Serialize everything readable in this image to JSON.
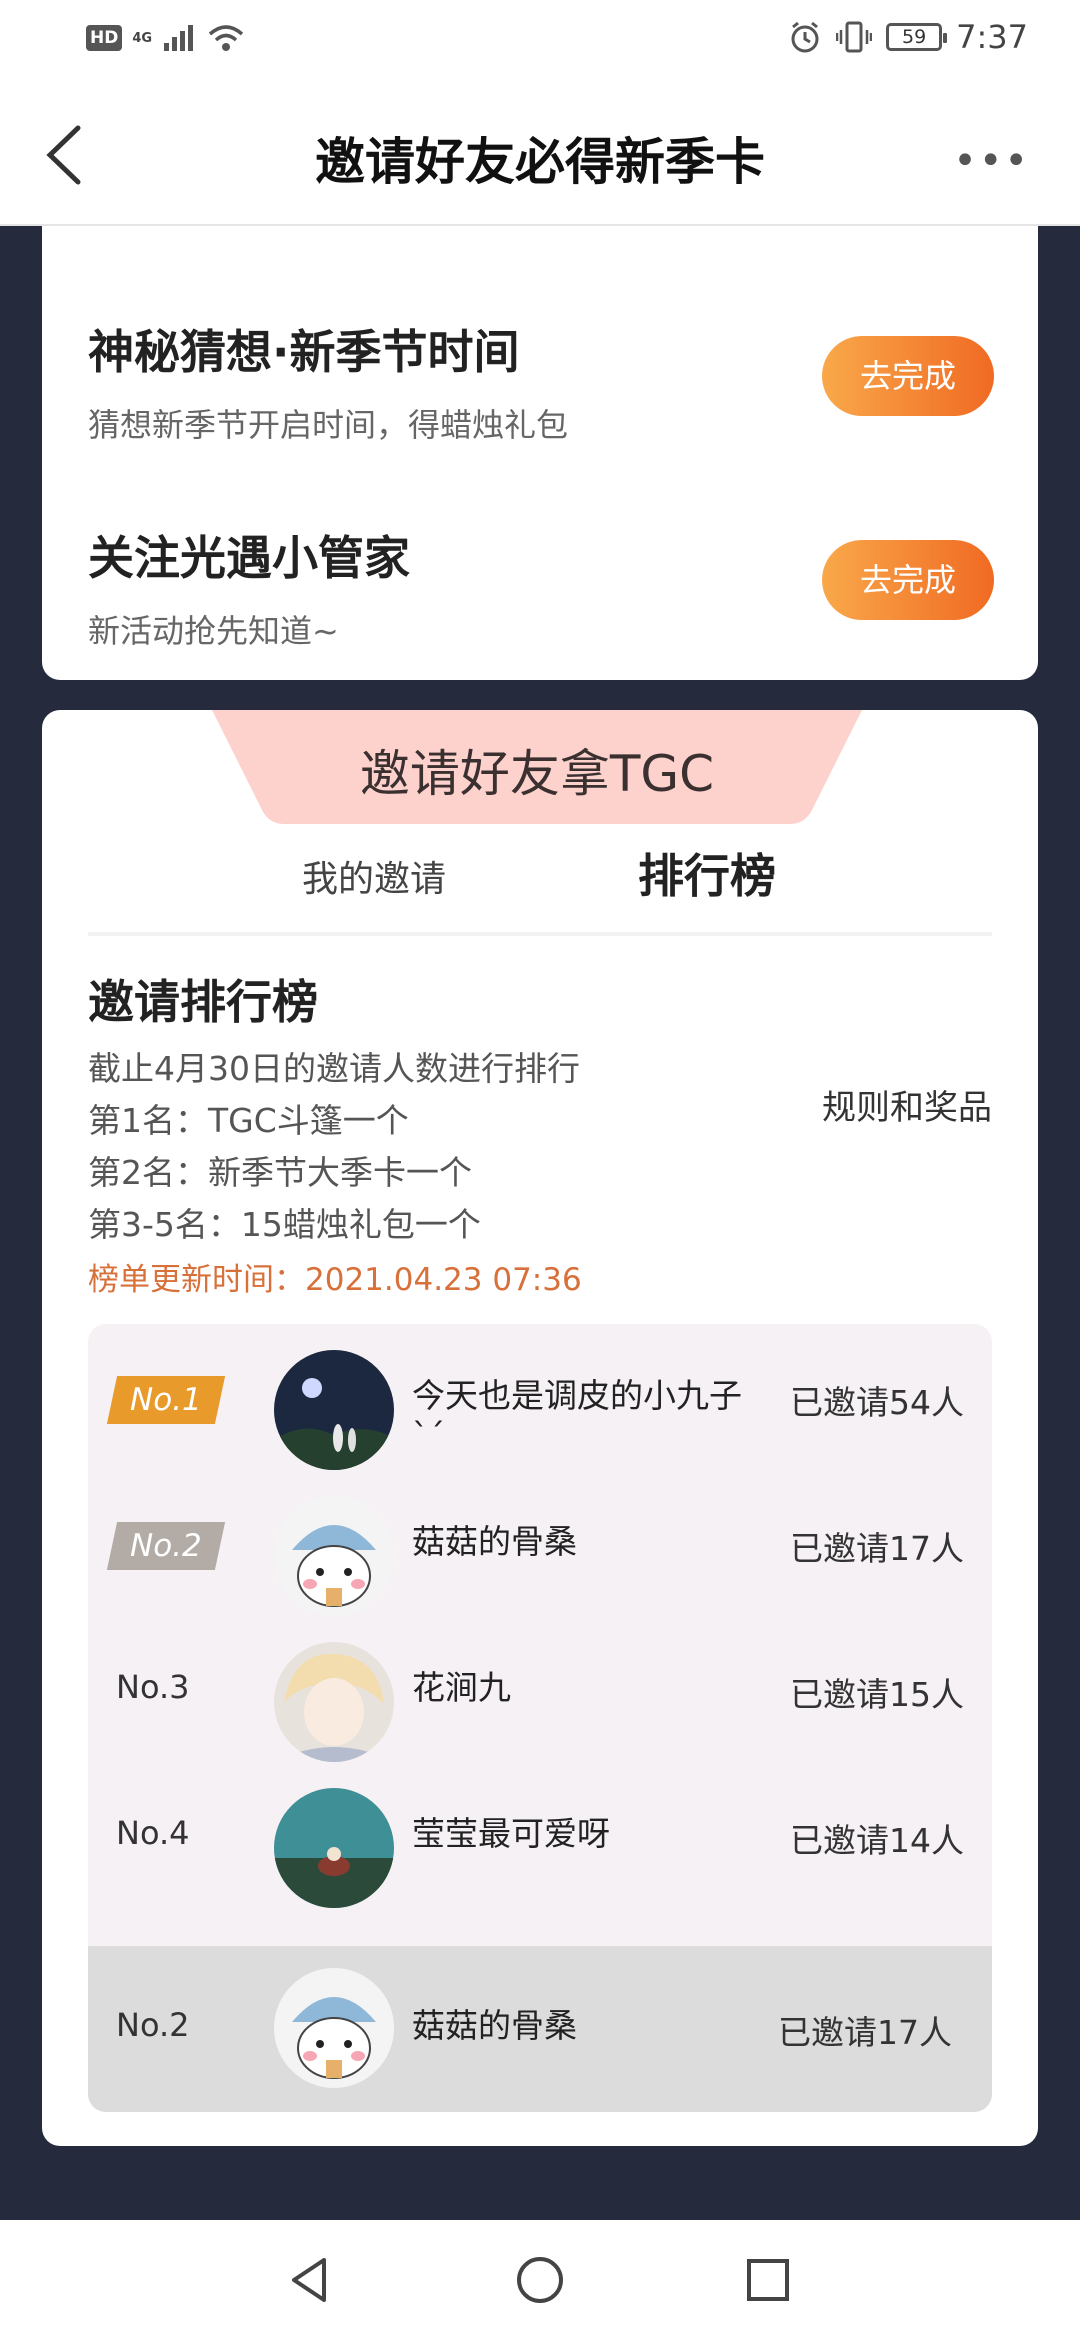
{
  "status_bar": {
    "hd": "HD",
    "network": "4G",
    "battery": "59",
    "time": "7:37"
  },
  "header": {
    "title": "邀请好友必得新季卡",
    "more": "•••"
  },
  "tasks": [
    {
      "title": "神秘猜想·新季节时间",
      "subtitle": "猜想新季节开启时间，得蜡烛礼包",
      "button": "去完成"
    },
    {
      "title": "关注光遇小管家",
      "subtitle": "新活动抢先知道~",
      "button": "去完成"
    }
  ],
  "invite": {
    "banner": "邀请好友拿TGC",
    "tabs": {
      "my_invites": "我的邀请",
      "leaderboard": "排行榜"
    },
    "rank_title": "邀请排行榜",
    "rules": [
      "截止4月30日的邀请人数进行排行",
      "第1名：TGC斗篷一个",
      "第2名：新季节大季卡一个",
      "第3-5名：15蜡烛礼包一个"
    ],
    "update_time": "榜单更新时间：2021.04.23 07:36",
    "rules_link": "规则和奖品"
  },
  "colors": {
    "accent": "#f06a23",
    "banner_pink": "#fdd1cc",
    "gold": "#e89a2a",
    "silver": "#b3aca6"
  },
  "leaderboard": [
    {
      "rank": "No.1",
      "name": "今天也是调皮的小九子ˋˊ",
      "invited": "已邀请54人"
    },
    {
      "rank": "No.2",
      "name": "菇菇的骨桑",
      "invited": "已邀请17人"
    },
    {
      "rank": "No.3",
      "name": "花涧九",
      "invited": "已邀请15人"
    },
    {
      "rank": "No.4",
      "name": "莹莹最可爱呀",
      "invited": "已邀请14人"
    }
  ],
  "my_rank": {
    "rank": "No.2",
    "name": "菇菇的骨桑",
    "invited": "已邀请17人"
  }
}
